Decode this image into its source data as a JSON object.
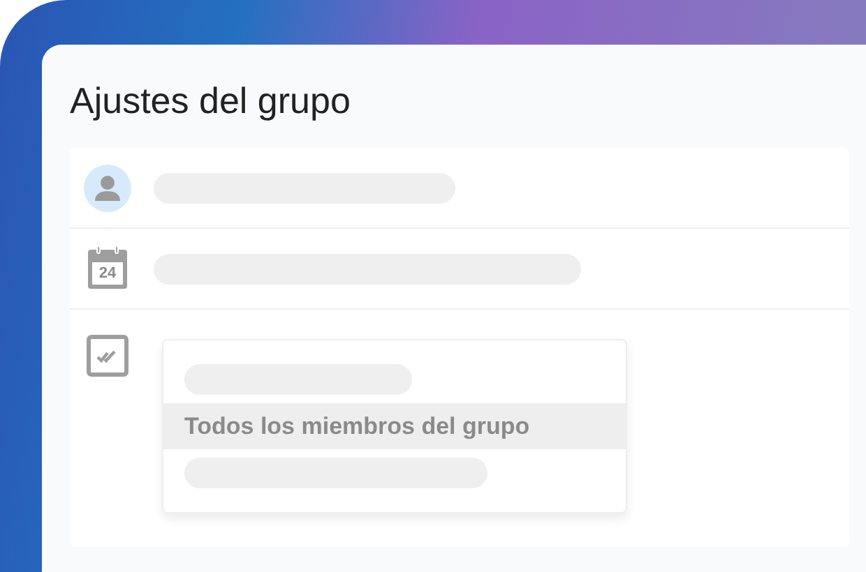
{
  "title": "Ajustes del grupo",
  "rows": [
    {
      "kind": "avatar"
    },
    {
      "kind": "calendar",
      "day": "24"
    },
    {
      "kind": "menu",
      "options": [
        {
          "kind": "placeholder",
          "selected": false
        },
        {
          "kind": "text",
          "label": "Todos los miembros del grupo",
          "selected": true
        },
        {
          "kind": "placeholder",
          "selected": false
        }
      ]
    }
  ]
}
